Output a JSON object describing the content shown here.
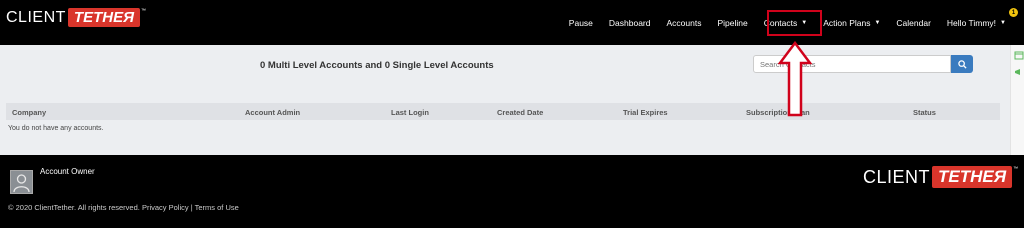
{
  "brand": {
    "client": "CLIENT",
    "tether": "TETHEЯ",
    "tm": "™"
  },
  "nav": {
    "items": [
      "Pause",
      "Dashboard",
      "Accounts",
      "Pipeline",
      "Contacts",
      "Action Plans",
      "Calendar",
      "Hello Timmy!"
    ],
    "notification_count": "1"
  },
  "main": {
    "heading": "0 Multi Level Accounts and 0 Single Level Accounts",
    "search_placeholder": "Search Contacts",
    "columns": [
      "Company",
      "Account Admin",
      "Last Login",
      "Created Date",
      "Trial Expires",
      "Subscription Plan",
      "Status"
    ],
    "empty_message": "You do not have any accounts."
  },
  "footer": {
    "owner_label": "Account Owner",
    "copyright": "© 2020 ClientTether. All rights reserved.",
    "privacy": "Privacy Policy",
    "separator": "|",
    "terms": "Terms of Use"
  },
  "colors": {
    "brand_red": "#d9352b",
    "highlight_red": "#d0021b",
    "button_blue": "#3a7bbf"
  },
  "icons": [
    "search-icon",
    "user-icon",
    "up-arrow-annotation",
    "caret-down-icon"
  ]
}
